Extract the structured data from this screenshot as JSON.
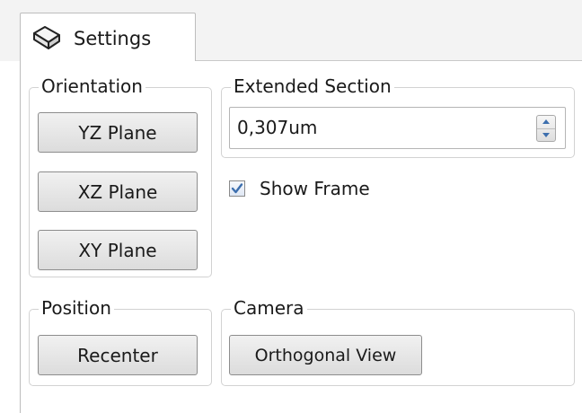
{
  "tab": {
    "label": "Settings",
    "icon": "settings-box-icon"
  },
  "orientation": {
    "title": "Orientation",
    "buttons": [
      "YZ Plane",
      "XZ Plane",
      "XY Plane"
    ]
  },
  "extended_section": {
    "title": "Extended Section",
    "value": "0,307um",
    "show_frame_label": "Show Frame",
    "show_frame_checked": true
  },
  "position": {
    "title": "Position",
    "recenter_label": "Recenter"
  },
  "camera": {
    "title": "Camera",
    "view_label": "Orthogonal View"
  },
  "colors": {
    "accent": "#3d6fae",
    "button_border": "#8d8d8d",
    "group_border": "#d2d2d2"
  }
}
